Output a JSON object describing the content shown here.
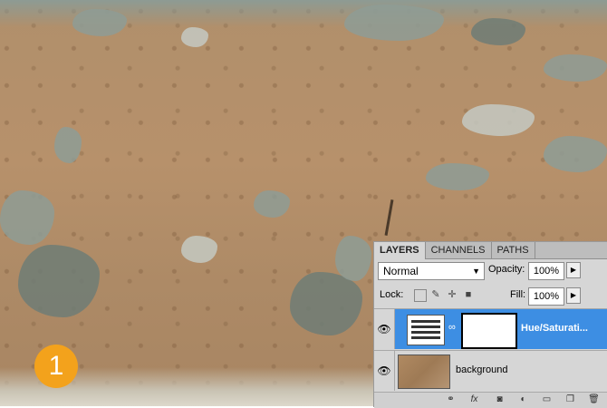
{
  "step_badge": "1",
  "layers_panel": {
    "tabs": [
      "LAYERS",
      "CHANNELS",
      "PATHS"
    ],
    "active_tab": "LAYERS",
    "blend_mode": "Normal",
    "opacity_label": "Opacity:",
    "opacity_value": "100%",
    "lock_label": "Lock:",
    "fill_label": "Fill:",
    "fill_value": "100%",
    "layers": [
      {
        "name": "Hue/Saturati...",
        "selected": true,
        "icon": "hue-saturation-adjustment-icon"
      },
      {
        "name": "background",
        "selected": false,
        "icon": "image-thumbnail"
      }
    ],
    "footer_icons": [
      "link-layers-icon",
      "fx-icon",
      "add-mask-icon",
      "new-adjustment-icon",
      "new-group-icon",
      "new-layer-icon",
      "trash-icon"
    ]
  },
  "colors": {
    "selection": "#3d8ee3",
    "badge": "#f3a21c"
  }
}
